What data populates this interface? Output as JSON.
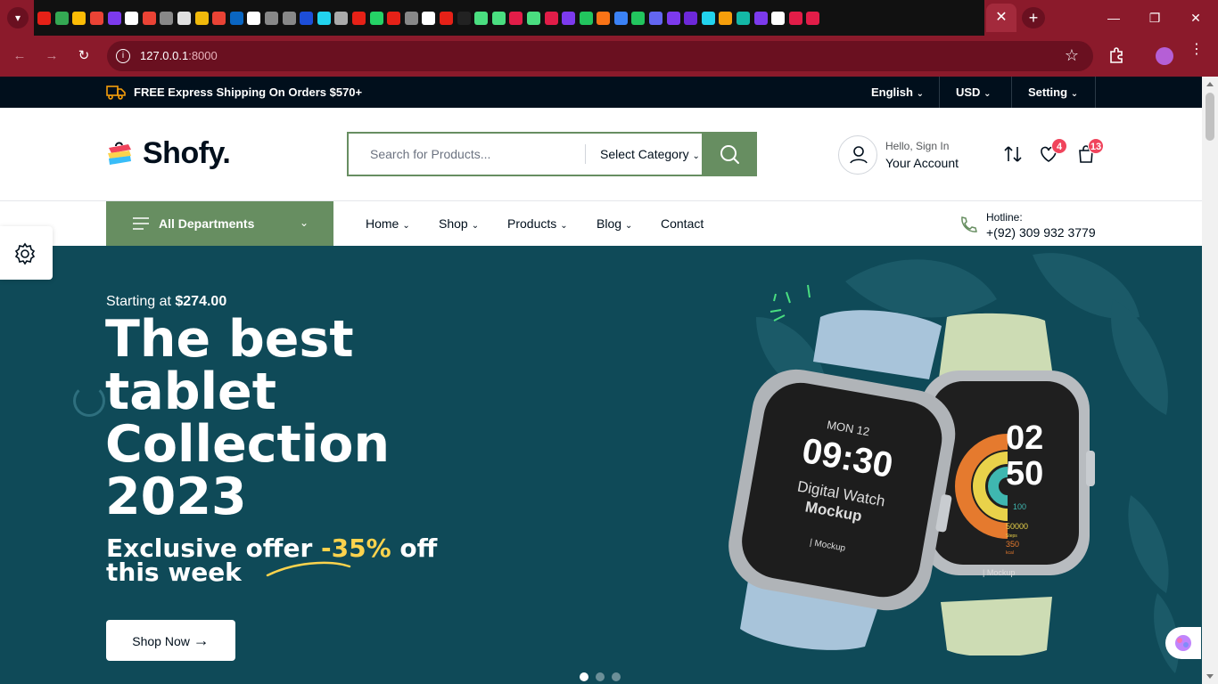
{
  "browser": {
    "url_host": "127.0.0.1",
    "url_port": ":8000",
    "active_tab_close": "✕",
    "new_tab": "+"
  },
  "topbar": {
    "shipping_text": "FREE Express Shipping On Orders $570+",
    "language": "English",
    "currency": "USD",
    "setting": "Setting"
  },
  "header": {
    "logo_text": "Shofy.",
    "search_placeholder": "Search for Products...",
    "category_label": "Select Category",
    "hello_text": "Hello, Sign In",
    "account_text": "Your Account",
    "wishlist_count": "4",
    "cart_count": "13"
  },
  "nav": {
    "departments_label": "All Departments",
    "items": [
      {
        "label": "Home"
      },
      {
        "label": "Shop"
      },
      {
        "label": "Products"
      },
      {
        "label": "Blog"
      },
      {
        "label": "Contact"
      }
    ],
    "hotline_label": "Hotline:",
    "hotline_number": "+(92) 309 932 3779"
  },
  "hero": {
    "starting_text": "Starting at ",
    "starting_price": "$274.00",
    "title": "The best tablet Collection 2023",
    "offer_before": "Exclusive offer ",
    "offer_highlight": "-35%",
    "offer_after": " off this week",
    "cta_label": "Shop Now",
    "watch1_date": "MON 12",
    "watch1_time": "09:30",
    "watch1_line1": "Digital Watch",
    "watch1_line2": "Mockup",
    "watch1_brand": "| Mockup",
    "watch2_hours": "02",
    "watch2_minutes": "50",
    "watch2_stat1": "100",
    "watch2_stat2": "50000",
    "watch2_stat2_unit": "Steps",
    "watch2_stat3": "350",
    "watch2_stat3_unit": "kcal",
    "watch2_brand": "| Mockup",
    "slides": 3,
    "active_slide": 1
  },
  "colors": {
    "brand_green": "#678e61",
    "topbar_bg": "#010f1c",
    "hero_bg": "#0f4a58",
    "badge_red": "#f0445c",
    "chrome_red": "#8b1a2b"
  }
}
